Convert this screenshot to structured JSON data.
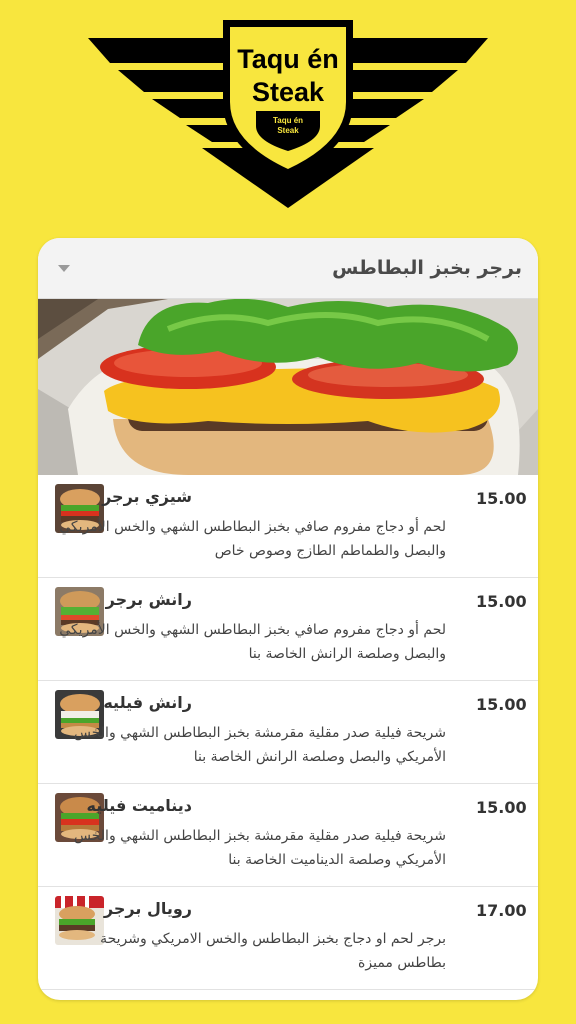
{
  "brand": {
    "name_line1": "Taqu én",
    "name_line2": "Steak",
    "badge_line1": "Taqu én",
    "badge_line2": "Steak"
  },
  "category": {
    "title": "برجر بخبز البطاطس"
  },
  "items": [
    {
      "name": "شيزي برجر",
      "price": "15.00",
      "description": "لحم أو دجاج مفروم صافي بخبز البطاطس الشهي والخس الأمريكي والبصل والطماطم الطازج وصوص خاص"
    },
    {
      "name": "رانش برجر",
      "price": "15.00",
      "description": "لحم أو دجاج مفروم صافي بخبز البطاطس الشهي والخس الأمريكي والبصل وصلصة الرانش الخاصة بنا"
    },
    {
      "name": "رانش فيليه",
      "price": "15.00",
      "description": "شريحة فيلية صدر مقلية مقرمشة بخبز البطاطس الشهي والخس الأمريكي والبصل وصلصة الرانش الخاصة بنا"
    },
    {
      "name": "ديناميت فيليه",
      "price": "15.00",
      "description": "شريحة فيلية صدر مقلية مقرمشة بخبز البطاطس الشهي والخس الأمريكي وصلصة الديناميت الخاصة بنا"
    },
    {
      "name": "رويال برجر",
      "price": "17.00",
      "description": "برجر لحم او دجاج بخبز البطاطس والخس الامريكي وشريحة بطاطس مميزة"
    }
  ]
}
